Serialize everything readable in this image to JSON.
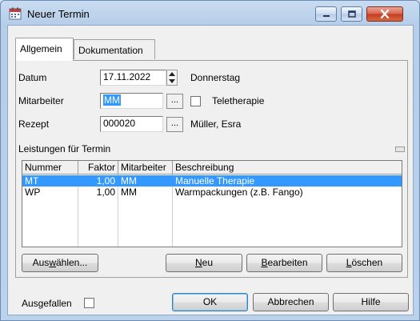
{
  "window": {
    "title": "Neuer Termin"
  },
  "tabs": [
    {
      "label": "Allgemein"
    },
    {
      "label": "Dokumentation"
    }
  ],
  "form": {
    "datum_label": "Datum",
    "datum_value": "17.11.2022",
    "weekday": "Donnerstag",
    "mitarbeiter_label": "Mitarbeiter",
    "mitarbeiter_value": "MM",
    "teletherapie_label": "Teletherapie",
    "rezept_label": "Rezept",
    "rezept_value": "000020",
    "patient_name": "Müller, Esra",
    "browse_label": "...",
    "leistungen_label": "Leistungen für Termin"
  },
  "table": {
    "columns": [
      "Nummer",
      "Faktor",
      "Mitarbeiter",
      "Beschreibung"
    ],
    "rows": [
      {
        "nummer": "MT",
        "faktor": "1,00",
        "mitarbeiter": "MM",
        "beschreibung": "Manuelle Therapie"
      },
      {
        "nummer": "WP",
        "faktor": "1,00",
        "mitarbeiter": "MM",
        "beschreibung": "Warmpackungen (z.B. Fango)"
      }
    ]
  },
  "panel_buttons": {
    "auswaehlen_pre": "Aus",
    "auswaehlen_key": "w",
    "auswaehlen_post": "ählen...",
    "neu_key": "N",
    "neu_post": "eu",
    "bearbeiten_key": "B",
    "bearbeiten_post": "earbeiten",
    "loeschen_key": "L",
    "loeschen_post": "öschen"
  },
  "footer": {
    "ausgefallen_label": "Ausgefallen",
    "ok_label": "OK",
    "abbrechen_label": "Abbrechen",
    "hilfe_label": "Hilfe"
  },
  "colors": {
    "selection": "#3399ff",
    "titlebar": "#c9dcf1",
    "close_button": "#c43c22"
  },
  "icons": {
    "app": "calendar-icon",
    "minimize": "minimize-icon",
    "maximize": "maximize-icon",
    "close": "close-icon"
  }
}
